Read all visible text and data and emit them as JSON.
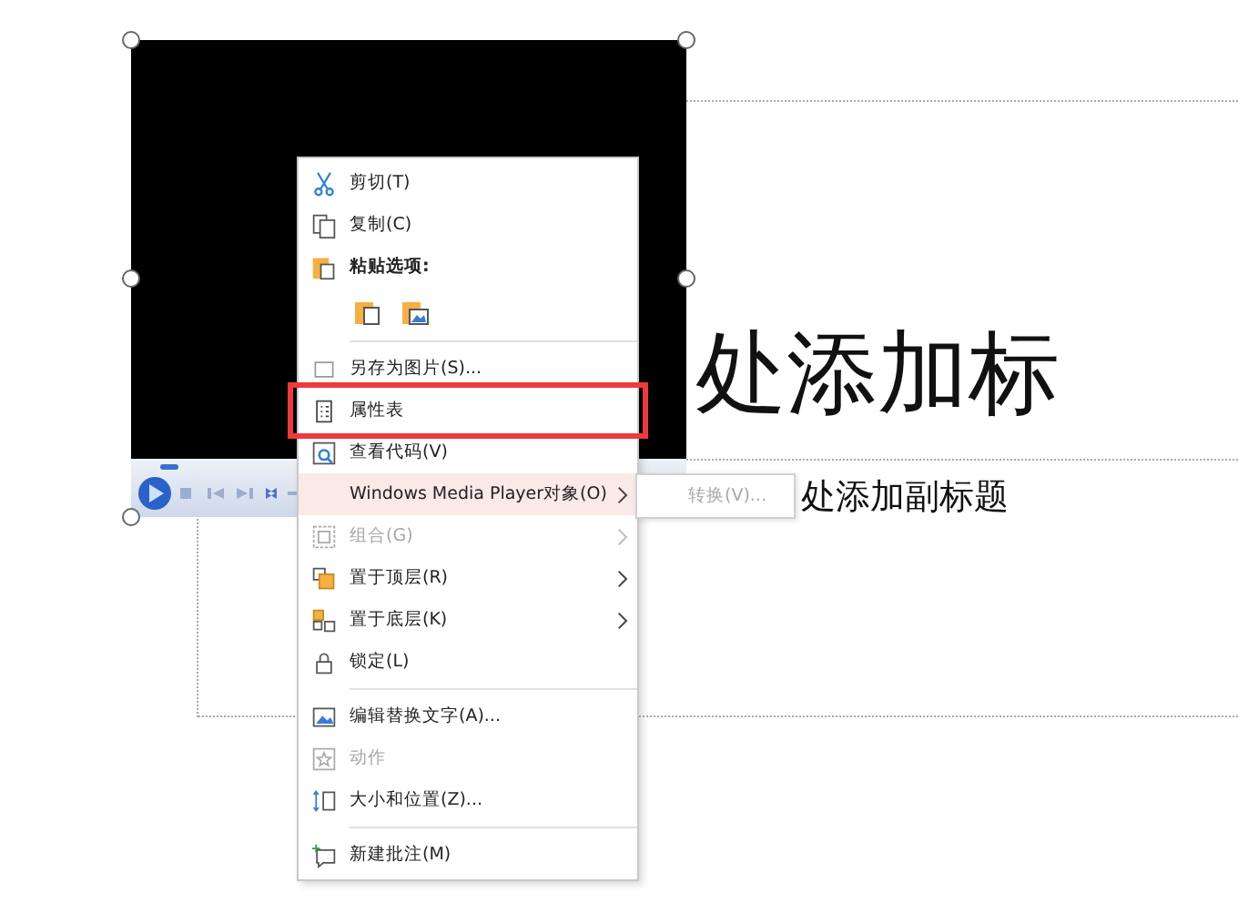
{
  "slide": {
    "title": "处添加标",
    "subtitle": "处添加副标题"
  },
  "context_menu": {
    "sections": [
      [
        {
          "label": "剪切(T)",
          "kind": "item",
          "disabled": false,
          "selected": false,
          "submenu": false,
          "outlined": false
        },
        {
          "label": "复制(C)",
          "kind": "item",
          "disabled": false,
          "selected": false,
          "submenu": false,
          "outlined": false
        },
        {
          "label": "粘贴选项:",
          "kind": "header",
          "disabled": false,
          "selected": false,
          "submenu": false,
          "outlined": false
        },
        {
          "kind": "paste_options"
        }
      ],
      [
        {
          "label": "另存为图片(S)...",
          "kind": "item",
          "disabled": false,
          "selected": false,
          "submenu": false,
          "outlined": false
        },
        {
          "label": "属性表",
          "kind": "item",
          "disabled": false,
          "selected": false,
          "submenu": false,
          "outlined": true
        },
        {
          "label": "查看代码(V)",
          "kind": "item",
          "disabled": false,
          "selected": false,
          "submenu": false,
          "outlined": false
        },
        {
          "label": "Windows Media Player对象(O)",
          "kind": "item",
          "disabled": false,
          "selected": true,
          "submenu": true,
          "outlined": false
        },
        {
          "label": "组合(G)",
          "kind": "item",
          "disabled": true,
          "selected": false,
          "submenu": true,
          "outlined": false
        },
        {
          "label": "置于顶层(R)",
          "kind": "item",
          "disabled": false,
          "selected": false,
          "submenu": true,
          "outlined": false
        },
        {
          "label": "置于底层(K)",
          "kind": "item",
          "disabled": false,
          "selected": false,
          "submenu": true,
          "outlined": false
        },
        {
          "label": "锁定(L)",
          "kind": "item",
          "disabled": false,
          "selected": false,
          "submenu": false,
          "outlined": false
        }
      ],
      [
        {
          "label": "编辑替换文字(A)...",
          "kind": "item",
          "disabled": false,
          "selected": false,
          "submenu": false,
          "outlined": false
        },
        {
          "label": "动作",
          "kind": "item",
          "disabled": true,
          "selected": false,
          "submenu": false,
          "outlined": false
        },
        {
          "label": "大小和位置(Z)...",
          "kind": "item",
          "disabled": false,
          "selected": false,
          "submenu": false,
          "outlined": false
        }
      ],
      [
        {
          "label": "新建批注(M)",
          "kind": "item",
          "disabled": false,
          "selected": false,
          "submenu": false,
          "outlined": false
        }
      ]
    ]
  },
  "submenu": {
    "items": [
      {
        "label": "转换(V)...",
        "disabled": true
      }
    ]
  }
}
